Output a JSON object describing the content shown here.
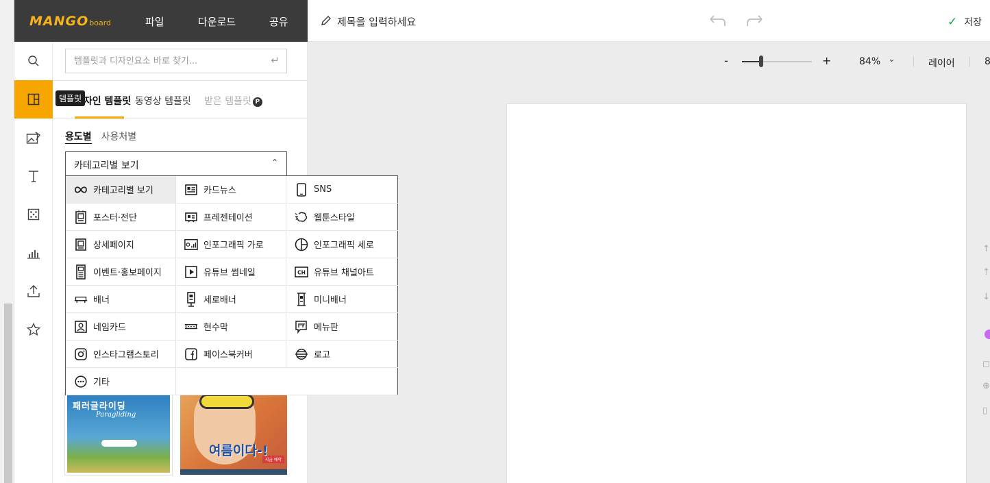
{
  "app": {
    "logo_main": "MANGO",
    "logo_sub": "board",
    "menu": [
      "파일",
      "다운로드",
      "공유"
    ]
  },
  "header": {
    "title_placeholder": "제목을 입력하세요",
    "save_label": "저장 "
  },
  "zoom": {
    "minus": "-",
    "plus": "+",
    "value": "84%",
    "level": 0.27,
    "layer_label": "레이어",
    "extra": "8"
  },
  "rail": {
    "tooltip": "템플릿",
    "items": [
      "search-icon",
      "template-icon",
      "image-icon",
      "text-icon",
      "element-icon",
      "chart-icon",
      "upload-icon",
      "star-icon"
    ],
    "active_color": "#f7a600"
  },
  "panel": {
    "search_placeholder": "템플릿과 디자인요소 바로 찾기...",
    "tabs": [
      {
        "label": "디자인 템플릿"
      },
      {
        "label": "동영상 템플릿"
      },
      {
        "label": "받은 템플릿"
      }
    ],
    "tab_badge": "P",
    "subtabs": [
      "용도별",
      "사용처별"
    ],
    "select_value": "카테고리별 보기"
  },
  "dropdown": {
    "items": [
      {
        "label": "카테고리별 보기",
        "icon": "infinity-icon"
      },
      {
        "label": "카드뉴스",
        "icon": "cardnews-icon"
      },
      {
        "label": "SNS",
        "icon": "phone-icon"
      },
      {
        "label": "포스터·전단",
        "icon": "poster-icon"
      },
      {
        "label": "프레젠테이션",
        "icon": "presentation-icon"
      },
      {
        "label": "웹툰스타일",
        "icon": "webtoon-icon"
      },
      {
        "label": "상세페이지",
        "icon": "detail-page-icon"
      },
      {
        "label": "인포그래픽 가로",
        "icon": "infographic-horizontal-icon"
      },
      {
        "label": "인포그래픽 세로",
        "icon": "infographic-vertical-icon"
      },
      {
        "label": "이벤트·홍보페이지",
        "icon": "event-page-icon"
      },
      {
        "label": "유튜브 썸네일",
        "icon": "youtube-thumbnail-icon"
      },
      {
        "label": "유튜브 채널아트",
        "icon": "youtube-channel-icon"
      },
      {
        "label": "배너",
        "icon": "banner-icon"
      },
      {
        "label": "세로배너",
        "icon": "vertical-banner-icon"
      },
      {
        "label": "미니배너",
        "icon": "mini-banner-icon"
      },
      {
        "label": "네임카드",
        "icon": "namecard-icon"
      },
      {
        "label": "현수막",
        "icon": "placard-icon"
      },
      {
        "label": "메뉴판",
        "icon": "menu-board-icon"
      },
      {
        "label": "인스타그램스토리",
        "icon": "instagram-icon"
      },
      {
        "label": "페이스북커버",
        "icon": "facebook-icon"
      },
      {
        "label": "로고",
        "icon": "logo-icon"
      },
      {
        "label": "기타",
        "icon": "more-icon"
      }
    ]
  },
  "thumbnails": {
    "first_title": "패러글라이딩",
    "first_sub": "Paragliding",
    "second_title": "여름이다-!",
    "second_badge": "지금 예약"
  }
}
